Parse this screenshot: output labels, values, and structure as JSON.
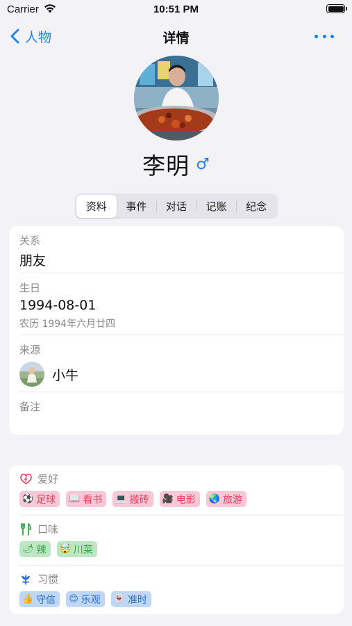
{
  "status_bar": {
    "carrier": "Carrier",
    "time": "10:51 PM"
  },
  "nav": {
    "back_label": "人物",
    "title": "详情"
  },
  "profile": {
    "name": "李明",
    "gender_symbol": "♂"
  },
  "tabs": [
    {
      "label": "资料",
      "active": true
    },
    {
      "label": "事件",
      "active": false
    },
    {
      "label": "对话",
      "active": false
    },
    {
      "label": "记账",
      "active": false
    },
    {
      "label": "纪念",
      "active": false
    }
  ],
  "info": {
    "relation": {
      "label": "关系",
      "value": "朋友"
    },
    "birthday": {
      "label": "生日",
      "value": "1994-08-01",
      "lunar": "农历  1994年六月廿四"
    },
    "source": {
      "label": "来源",
      "name": "小牛"
    },
    "notes": {
      "label": "备注",
      "value": ""
    }
  },
  "hobbies": {
    "label": "爱好",
    "icon": "heart-icon",
    "items": [
      {
        "emoji": "⚽",
        "label": "足球"
      },
      {
        "emoji": "📖",
        "label": "看书"
      },
      {
        "emoji": "💻",
        "label": "搬砖"
      },
      {
        "emoji": "🎥",
        "label": "电影"
      },
      {
        "emoji": "🌏",
        "label": "旅游"
      }
    ]
  },
  "tastes": {
    "label": "口味",
    "icon": "fork-knife-icon",
    "items": [
      {
        "emoji": "🌶",
        "label": "辣"
      },
      {
        "emoji": "🤯",
        "label": "川菜"
      }
    ]
  },
  "habits": {
    "label": "习惯",
    "icon": "flower-icon",
    "items": [
      {
        "emoji": "👍",
        "label": "守信"
      },
      {
        "emoji": "😊",
        "label": "乐观"
      },
      {
        "emoji": "👻",
        "label": "准时"
      }
    ]
  },
  "colors": {
    "accent": "#1a7ff5",
    "hobby_tag_bg": "#f9c8d7",
    "hobby_tag_text": "#e0415f",
    "taste_tag_bg": "#bde7c3",
    "taste_tag_text": "#37a84c",
    "habit_tag_bg": "#bfd7f5",
    "habit_tag_text": "#2a6fd0"
  }
}
